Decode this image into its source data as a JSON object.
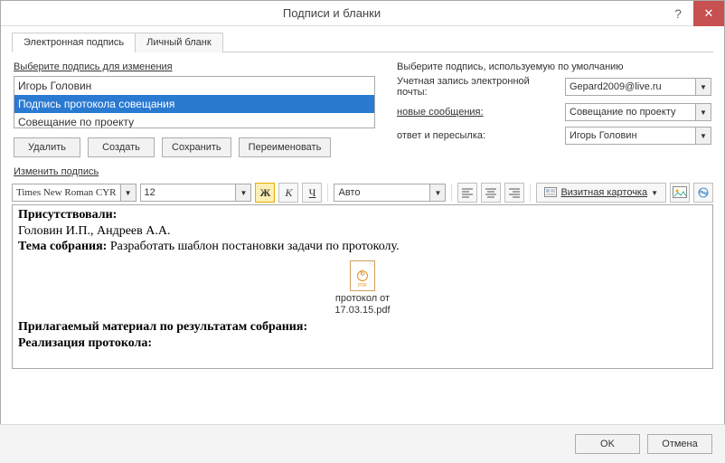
{
  "window": {
    "title": "Подписи и бланки",
    "help": "?",
    "close": "✕"
  },
  "tabs": {
    "t1": "Электронная подпись",
    "t2": "Личный бланк"
  },
  "left": {
    "label": "Выберите подпись для изменения",
    "items": [
      "Игорь Головин",
      "Подпись протокола совещания",
      "Совещание по проекту"
    ],
    "buttons": {
      "delete": "Удалить",
      "create": "Создать",
      "save": "Сохранить",
      "rename": "Переименовать"
    }
  },
  "right": {
    "label": "Выберите подпись, используемую по умолчанию",
    "account_label": "Учетная запись электронной почты:",
    "account_value": "Gepard2009@live.ru",
    "new_label": "новые сообщения:",
    "new_value": "Совещание по проекту",
    "reply_label": "ответ и пересылка:",
    "reply_value": "Игорь Головин"
  },
  "edit": {
    "label": "Изменить подпись",
    "font": "Times New Roman CYR",
    "size": "12",
    "bold": "Ж",
    "italic": "К",
    "underline": "Ч",
    "color": "Авто",
    "card": "Визитная карточка",
    "body": {
      "attendees_label": "Присутствовали:",
      "attendees": "Головин И.П., Андреев А.А.",
      "topic_label": "Тема собрания:",
      "topic": " Разработать шаблон постановки задачи по протоколу.",
      "attach_line1": "протокол от",
      "attach_line2": "17.03.15.pdf",
      "material_label": "Прилагаемый материал по результатам собрания:",
      "realization_label": "Реализация протокола:"
    }
  },
  "footer": {
    "ok": "OK",
    "cancel": "Отмена"
  }
}
